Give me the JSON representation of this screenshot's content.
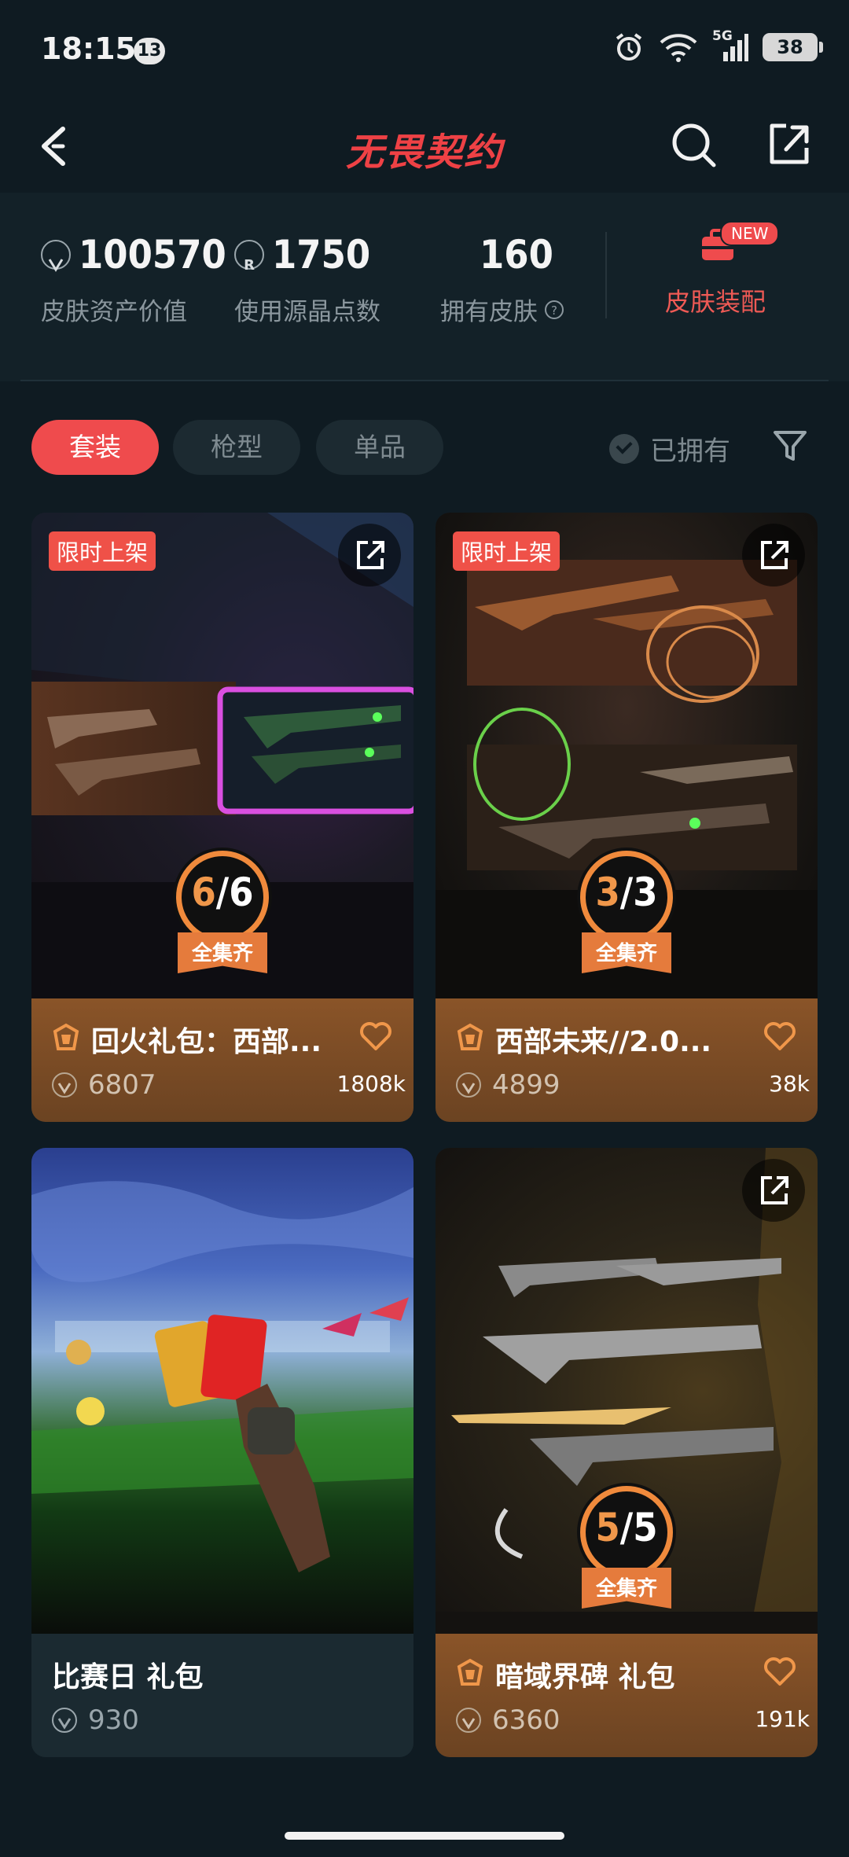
{
  "status_bar": {
    "time": "18:15",
    "notification_count": "13",
    "network": "5G",
    "battery": "38"
  },
  "header": {
    "title": "无畏契约",
    "back_icon": "back-arrow-icon",
    "search_icon": "search-icon",
    "share_icon": "share-icon"
  },
  "stats": {
    "asset_value": "100570",
    "asset_label": "皮肤资产价值",
    "radianite_points": "1750",
    "radianite_label": "使用源晶点数",
    "owned_skins": "160",
    "owned_label": "拥有皮肤",
    "equip_label": "皮肤装配",
    "equip_badge": "NEW"
  },
  "filters": {
    "tabs": [
      "套装",
      "枪型",
      "单品"
    ],
    "active_tab": "套装",
    "owned_label": "已拥有"
  },
  "cards": [
    {
      "tag": "限时上架",
      "title": "回火礼包：西部...",
      "price": "6807",
      "likes": "1808k",
      "owned": "6",
      "total": "6",
      "complete_label": "全集齐",
      "info_style": "gold"
    },
    {
      "tag": "限时上架",
      "title": "西部未来//2.0...",
      "price": "4899",
      "likes": "38k",
      "owned": "3",
      "total": "3",
      "complete_label": "全集齐",
      "info_style": "gold"
    },
    {
      "tag": "",
      "title": "比赛日 礼包",
      "price": "930",
      "likes": "",
      "owned": "",
      "total": "",
      "complete_label": "",
      "info_style": "plain"
    },
    {
      "tag": "",
      "title": "暗域界碑 礼包",
      "price": "6360",
      "likes": "191k",
      "owned": "5",
      "total": "5",
      "complete_label": "全集齐",
      "info_style": "gold"
    }
  ],
  "colors": {
    "accent": "#ef4b4d",
    "gold": "#8a5428",
    "badge_orange": "#f08a3c",
    "background": "#0f1b22"
  }
}
